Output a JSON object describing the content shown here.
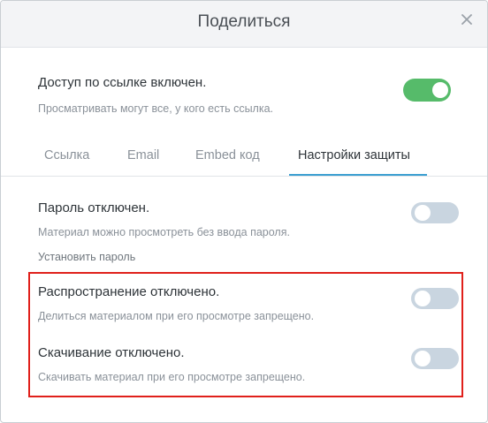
{
  "dialog": {
    "title": "Поделиться",
    "close_icon": "close-icon"
  },
  "link_access": {
    "title": "Доступ по ссылке включен.",
    "subtitle": "Просматривать могут все, у кого есть ссылка.",
    "enabled": true
  },
  "tabs": [
    {
      "label": "Ссылка",
      "active": false
    },
    {
      "label": "Email",
      "active": false
    },
    {
      "label": "Embed код",
      "active": false
    },
    {
      "label": "Настройки защиты",
      "active": true
    }
  ],
  "security": {
    "password": {
      "title": "Пароль отключен.",
      "subtitle": "Материал можно просмотреть без ввода пароля.",
      "set_link": "Установить пароль",
      "enabled": false
    },
    "sharing": {
      "title": "Распространение отключено.",
      "subtitle": "Делиться материалом при его просмотре запрещено.",
      "enabled": false
    },
    "download": {
      "title": "Скачивание отключено.",
      "subtitle": "Скачивать материал при его просмотре запрещено.",
      "enabled": false
    }
  },
  "colors": {
    "toggle_on": "#56bb6a",
    "toggle_off": "#c9d5e0",
    "tab_accent": "#3b9fd1",
    "highlight_border": "#e0201b"
  }
}
